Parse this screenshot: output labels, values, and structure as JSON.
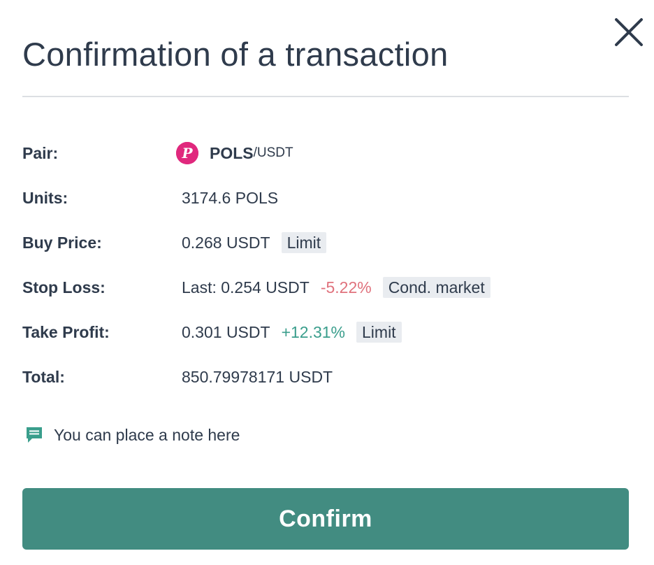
{
  "dialog": {
    "title": "Confirmation of a transaction",
    "close_icon": "close-icon"
  },
  "rows": {
    "pair": {
      "label": "Pair:",
      "coin_icon": "polkastarter-coin-icon",
      "coin_letter": "P",
      "base": "POLS",
      "quote": "/USDT"
    },
    "units": {
      "label": "Units:",
      "value": "3174.6 POLS"
    },
    "buy_price": {
      "label": "Buy Price:",
      "value": "0.268 USDT",
      "tag": "Limit"
    },
    "stop_loss": {
      "label": "Stop Loss:",
      "value": "Last: 0.254 USDT",
      "percent": "-5.22%",
      "tag": "Cond. market"
    },
    "take_profit": {
      "label": "Take Profit:",
      "value": "0.301 USDT",
      "percent": "+12.31%",
      "tag": "Limit"
    },
    "total": {
      "label": "Total:",
      "value": "850.79978171 USDT"
    }
  },
  "note": {
    "icon": "comment-icon",
    "text": "You can place a note here"
  },
  "confirm_button": {
    "label": "Confirm"
  },
  "colors": {
    "text": "#2f3b4c",
    "accent": "#428c81",
    "negative": "#e0727d",
    "positive": "#3a9e8c",
    "tag_background": "#e9ecf0",
    "coin": "#e0287d"
  }
}
